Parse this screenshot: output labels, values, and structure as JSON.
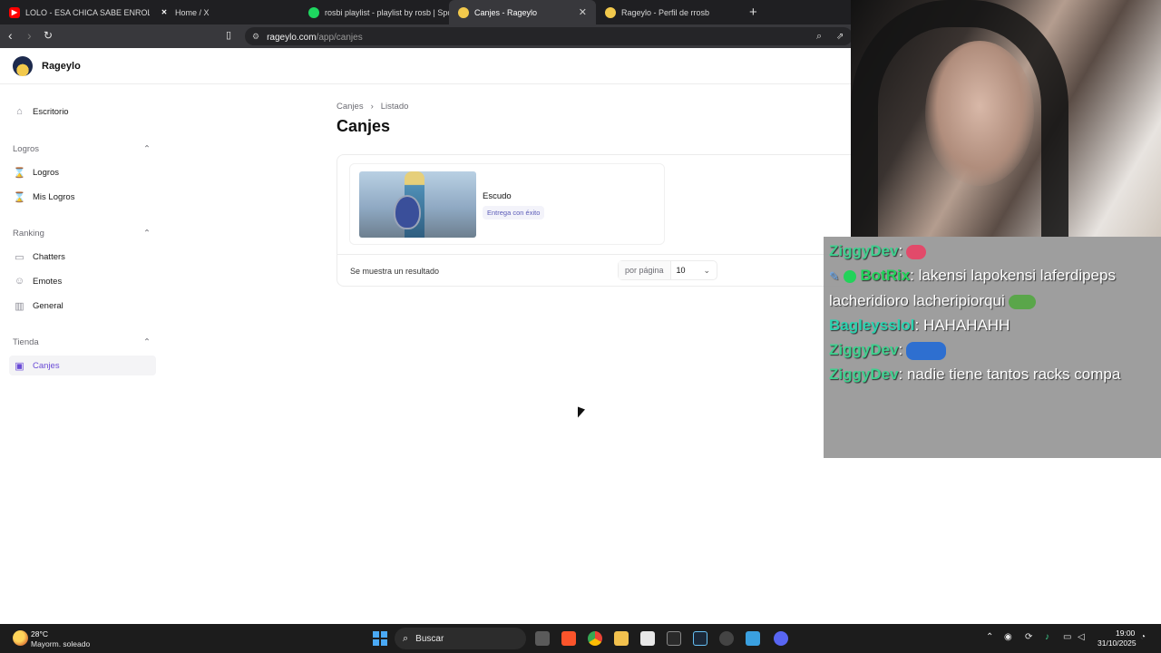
{
  "browser": {
    "tabs": [
      {
        "title": "LOLO - ESA CHICA SABE ENROLAR (",
        "favicon": "youtube-icon",
        "color": "#ff0000"
      },
      {
        "title": "Home / X",
        "favicon": "x-icon",
        "color": "#ffffff"
      },
      {
        "title": "rosbi playlist - playlist by rosb | Spot",
        "favicon": "spotify-icon",
        "color": "#1ed760"
      },
      {
        "title": "Canjes - Rageylo",
        "favicon": "rageylo-icon",
        "color": "#f2c94c",
        "active": true,
        "close": "✕"
      },
      {
        "title": "Rageylo - Perfil de rrosb",
        "favicon": "rageylo-icon",
        "color": "#f2c94c"
      }
    ],
    "new_tab": "+",
    "url_host": "rageylo.com",
    "url_path": "/app/canjes"
  },
  "app": {
    "brand": "Rageylo"
  },
  "sidebar": {
    "escritorio": "Escritorio",
    "groups": [
      {
        "title": "Logros",
        "items": [
          "Logros",
          "Mis Logros"
        ]
      },
      {
        "title": "Ranking",
        "items": [
          "Chatters",
          "Emotes",
          "General"
        ]
      },
      {
        "title": "Tienda",
        "items": [
          "Canjes"
        ]
      }
    ],
    "active_item": "Canjes"
  },
  "main": {
    "breadcrumb": [
      "Canjes",
      "Listado"
    ],
    "title": "Canjes",
    "item": {
      "name": "Escudo",
      "status": "Entrega con éxito"
    },
    "results_text": "Se muestra un resultado",
    "per_page_label": "por página",
    "per_page_value": "10"
  },
  "chat": {
    "messages": [
      {
        "user": "ZiggyDev",
        "user_color": "#3ecf8e",
        "text": ":",
        "emote": "heart-emote"
      },
      {
        "user": "BotRix",
        "user_color": "#22d35a",
        "text": ": lakensi lapokensi laferdipeps lacheridioro lacheripiorqui",
        "emote": "frog-emote"
      },
      {
        "user": "Bagleysslol",
        "user_color": "#2bd3b0",
        "text": ": HAHAHAHH"
      },
      {
        "user": "ZiggyDev",
        "user_color": "#3ecf8e",
        "text": ":",
        "emote": "car-emote"
      },
      {
        "user": "ZiggyDev",
        "user_color": "#3ecf8e",
        "text": ": nadie tiene tantos racks compa"
      }
    ]
  },
  "taskbar": {
    "temperature": "28°C",
    "weather": "Mayorm. soleado",
    "search": "Buscar",
    "time": "19:00",
    "date": "31/10/2025"
  }
}
